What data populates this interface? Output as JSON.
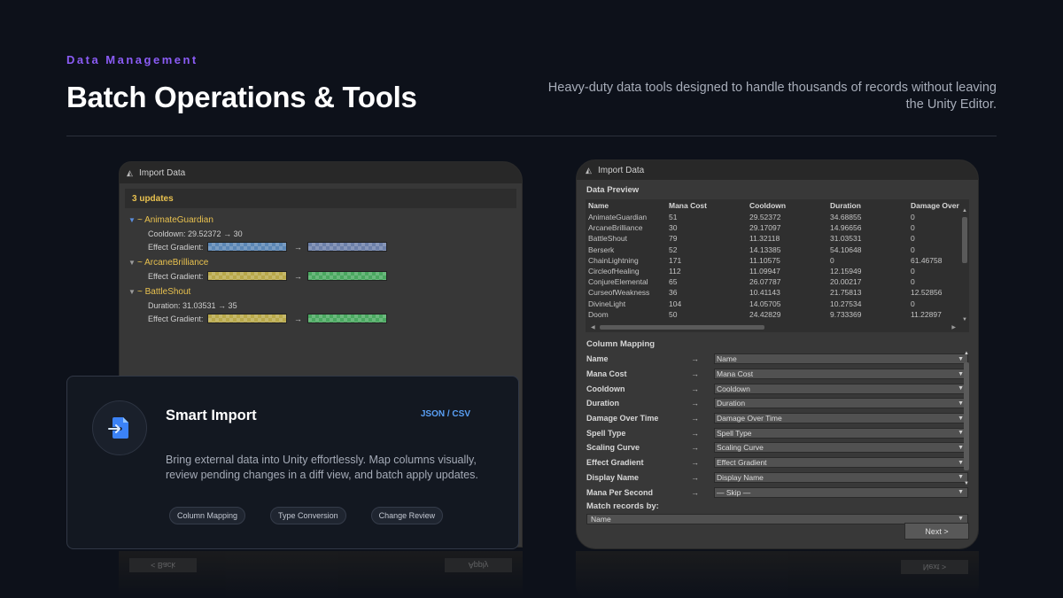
{
  "header": {
    "eyebrow": "Data Management",
    "title": "Batch Operations & Tools",
    "subtitle": "Heavy-duty data tools designed to handle thousands of records without leaving the Unity Editor."
  },
  "left_window": {
    "tab_title": "Import Data",
    "updates": "3 updates",
    "items": [
      {
        "name": "~ AnimateGuardian",
        "expanded": true,
        "change": "Cooldown: 29.52372 → 30",
        "gradient_label": "Effect Gradient:",
        "arrow": "→"
      },
      {
        "name": "~ ArcaneBrilliance",
        "expanded": false,
        "gradient_label": "Effect Gradient:",
        "arrow": "→"
      },
      {
        "name": "~ BattleShout",
        "expanded": false,
        "change": "Duration: 31.03531 → 35",
        "gradient_label": "Effect Gradient:",
        "arrow": "→"
      }
    ],
    "reflection_buttons": [
      "< Back",
      "Apply"
    ]
  },
  "card": {
    "title": "Smart Import",
    "tag": "JSON / CSV",
    "description": "Bring external data into Unity effortlessly. Map columns visually, review pending changes in a diff view, and batch apply updates.",
    "chips": [
      "Column Mapping",
      "Type Conversion",
      "Change Review"
    ],
    "icon": "file-import-icon",
    "accent": "#3b82f6"
  },
  "right_window": {
    "tab_title": "Import Data",
    "preview_label": "Data Preview",
    "columns": [
      "Name",
      "Mana Cost",
      "Cooldown",
      "Duration",
      "Damage Over"
    ],
    "rows": [
      [
        "AnimateGuardian",
        "51",
        "29.52372",
        "34.68855",
        "0"
      ],
      [
        "ArcaneBrilliance",
        "30",
        "29.17097",
        "14.96656",
        "0"
      ],
      [
        "BattleShout",
        "79",
        "11.32118",
        "31.03531",
        "0"
      ],
      [
        "Berserk",
        "52",
        "14.13385",
        "54.10648",
        "0"
      ],
      [
        "ChainLightning",
        "171",
        "11.10575",
        "0",
        "61.46758"
      ],
      [
        "CircleofHealing",
        "112",
        "11.09947",
        "12.15949",
        "0"
      ],
      [
        "ConjureElemental",
        "65",
        "26.07787",
        "20.00217",
        "0"
      ],
      [
        "CurseofWeakness",
        "36",
        "10.41143",
        "21.75813",
        "12.52856"
      ],
      [
        "DivineLight",
        "104",
        "14.05705",
        "10.27534",
        "0"
      ],
      [
        "Doom",
        "50",
        "24.42829",
        "9.733369",
        "11.22897"
      ]
    ],
    "mapping_label": "Column Mapping",
    "mappings": [
      {
        "source": "Name",
        "target": "Name"
      },
      {
        "source": "Mana Cost",
        "target": "Mana Cost"
      },
      {
        "source": "Cooldown",
        "target": "Cooldown"
      },
      {
        "source": "Duration",
        "target": "Duration"
      },
      {
        "source": "Damage Over Time",
        "target": "Damage Over Time"
      },
      {
        "source": "Spell Type",
        "target": "Spell Type"
      },
      {
        "source": "Scaling Curve",
        "target": "Scaling Curve"
      },
      {
        "source": "Effect Gradient",
        "target": "Effect Gradient"
      },
      {
        "source": "Display Name",
        "target": "Display Name"
      },
      {
        "source": "Mana Per Second",
        "target": "— Skip —"
      }
    ],
    "map_arrow": "→",
    "match_label": "Match records by:",
    "match_value": "Name",
    "next_button": "Next >"
  }
}
